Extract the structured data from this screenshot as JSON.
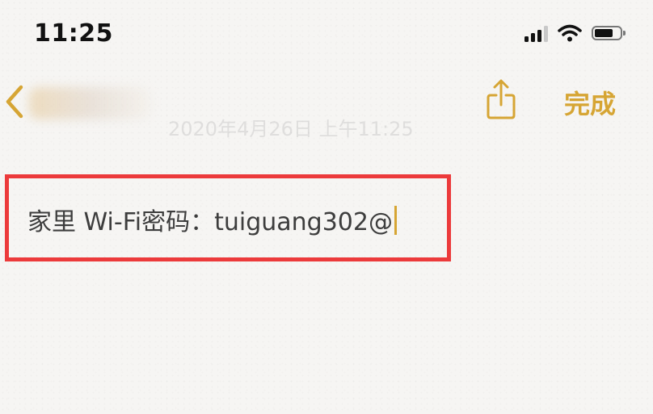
{
  "status_bar": {
    "time": "11:25",
    "icons": [
      "signal-icon",
      "wifi-icon",
      "battery-icon"
    ]
  },
  "nav": {
    "back_icon": "chevron-left-icon",
    "share_icon": "share-icon",
    "done_label": "完成",
    "date_text": "2020年4月26日 上午11:25"
  },
  "note": {
    "content": "家里 Wi-Fi密码：tuiguang302@"
  },
  "colors": {
    "accent": "#d6a534",
    "highlight_border": "#ec3a3b",
    "text": "#3d3d3d",
    "background": "#f6f5f3"
  }
}
